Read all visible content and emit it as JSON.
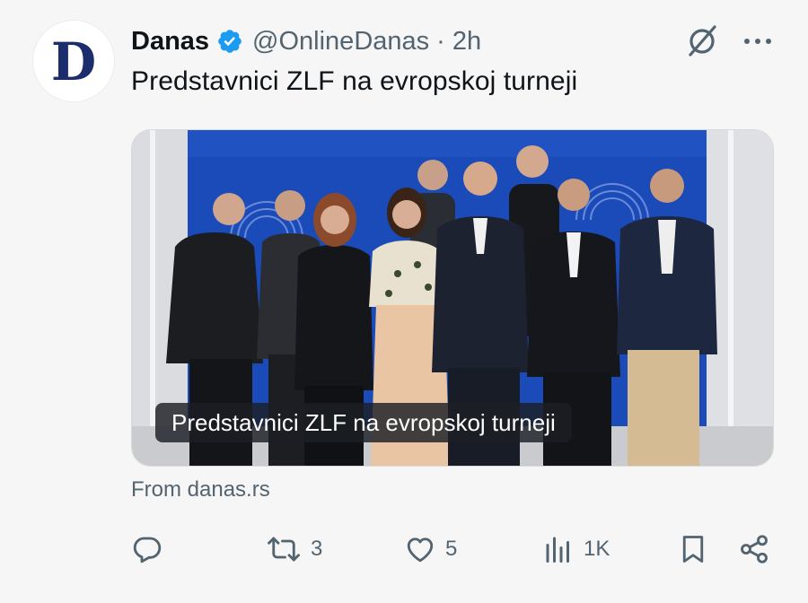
{
  "account": {
    "avatar_letter": "D",
    "display_name": "Danas",
    "handle": "@OnlineDanas",
    "separator": "·",
    "timestamp": "2h",
    "verified": true
  },
  "tweet": {
    "text": "Predstavnici ZLF na evropskoj turneji"
  },
  "media": {
    "caption": "Predstavnici ZLF na evropskoj turneji"
  },
  "link": {
    "source": "From danas.rs"
  },
  "actions": {
    "reply_count": "",
    "retweet_count": "3",
    "like_count": "5",
    "views_count": "1K"
  },
  "colors": {
    "verified_blue": "#1d9bf0",
    "secondary_text": "#536471",
    "background": "#f6f6f6",
    "stage_blue": "#1b4ab9"
  },
  "icons": [
    "verified-badge-icon",
    "grok-slash-icon",
    "more-options-icon",
    "reply-icon",
    "retweet-icon",
    "like-icon",
    "views-icon",
    "bookmark-icon",
    "share-icon"
  ]
}
